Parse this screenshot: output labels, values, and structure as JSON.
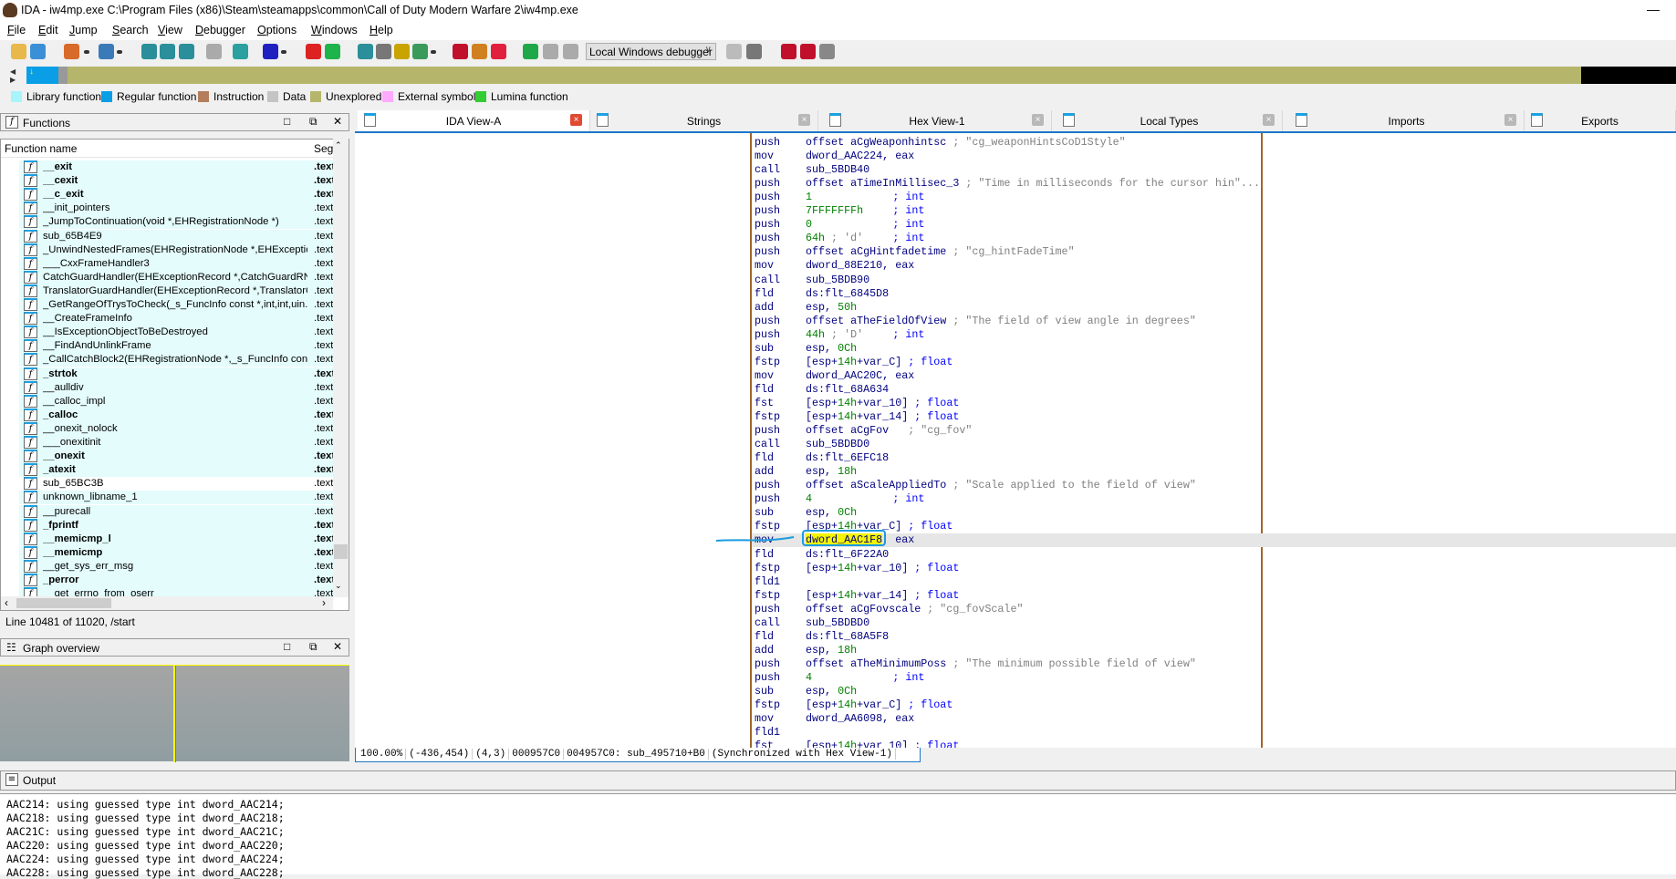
{
  "window": {
    "title": "IDA - iw4mp.exe C:\\Program Files (x86)\\Steam\\steamapps\\common\\Call of Duty Modern Warfare 2\\iw4mp.exe",
    "minimize": "—"
  },
  "menu": [
    "File",
    "Edit",
    "Jump",
    "Search",
    "View",
    "Debugger",
    "Options",
    "Windows",
    "Help"
  ],
  "toolbar": {
    "icons": [
      "open-icon",
      "save-icon",
      "back-icon",
      "dropdown-icon",
      "forward-icon",
      "dropdown-icon",
      "hex-icon",
      "text-icon",
      "binary-icon",
      "convert-icon",
      "jump-icon",
      "ascii-icon",
      "dropdown-icon",
      "segment-icon",
      "green-circle-icon",
      "code-icon",
      "data-icon",
      "unknown-icon",
      "struct-icon",
      "dropdown-icon",
      "breakpoint-icon",
      "patch-icon",
      "stop-sign-icon",
      "run-icon",
      "pause-icon",
      "stop-icon",
      "trace-icon",
      "call-trace-icon",
      "list-icon",
      "list-add-icon",
      "list-remove-icon"
    ],
    "debugger_select": "Local Windows debugger"
  },
  "legend": [
    {
      "label": "Library function",
      "color": "#a8f4fb"
    },
    {
      "label": "Regular function",
      "color": "#0a9ee6"
    },
    {
      "label": "Instruction",
      "color": "#b47e5c"
    },
    {
      "label": "Data",
      "color": "#c4c4c4"
    },
    {
      "label": "Unexplored",
      "color": "#b5b66b"
    },
    {
      "label": "External symbol",
      "color": "#ffaaff"
    },
    {
      "label": "Lumina function",
      "color": "#33cc33"
    }
  ],
  "functions_panel": {
    "title": "Functions",
    "col_name": "Function name",
    "col_seg": "Seg",
    "status": "Line 10481 of 11020, /start",
    "rows": [
      {
        "name": "__exit",
        "seg": ".text",
        "bold": true
      },
      {
        "name": "__cexit",
        "seg": ".text",
        "bold": true
      },
      {
        "name": "__c_exit",
        "seg": ".text",
        "bold": true
      },
      {
        "name": "__init_pointers",
        "seg": ".text"
      },
      {
        "name": "_JumpToContinuation(void *,EHRegistrationNode *)",
        "seg": ".text"
      },
      {
        "name": "sub_65B4E9",
        "seg": ".text"
      },
      {
        "name": "_UnwindNestedFrames(EHRegistrationNode *,EHExceptio...",
        "seg": ".text"
      },
      {
        "name": "___CxxFrameHandler3",
        "seg": ".text"
      },
      {
        "name": "CatchGuardHandler(EHExceptionRecord *,CatchGuardRN ...",
        "seg": ".text"
      },
      {
        "name": "TranslatorGuardHandler(EHExceptionRecord *,TranslatorG...",
        "seg": ".text"
      },
      {
        "name": "_GetRangeOfTrysToCheck(_s_FuncInfo const *,int,int,uin...",
        "seg": ".text"
      },
      {
        "name": "__CreateFrameInfo",
        "seg": ".text"
      },
      {
        "name": "__IsExceptionObjectToBeDestroyed",
        "seg": ".text"
      },
      {
        "name": "__FindAndUnlinkFrame",
        "seg": ".text"
      },
      {
        "name": "_CallCatchBlock2(EHRegistrationNode *,_s_FuncInfo cons...",
        "seg": ".text"
      },
      {
        "name": "_strtok",
        "seg": ".text",
        "bold": true
      },
      {
        "name": "__aulldiv",
        "seg": ".text"
      },
      {
        "name": "__calloc_impl",
        "seg": ".text"
      },
      {
        "name": "_calloc",
        "seg": ".text",
        "bold": true
      },
      {
        "name": "__onexit_nolock",
        "seg": ".text"
      },
      {
        "name": "___onexitinit",
        "seg": ".text"
      },
      {
        "name": "__onexit",
        "seg": ".text",
        "bold": true
      },
      {
        "name": "_atexit",
        "seg": ".text",
        "bold": true
      },
      {
        "name": "sub_65BC3B",
        "seg": ".text",
        "regular": true
      },
      {
        "name": "unknown_libname_1",
        "seg": ".text"
      },
      {
        "name": "__purecall",
        "seg": ".text"
      },
      {
        "name": "_fprintf",
        "seg": ".text",
        "bold": true
      },
      {
        "name": "__memicmp_l",
        "seg": ".text",
        "bold": true
      },
      {
        "name": "__memicmp",
        "seg": ".text",
        "bold": true
      },
      {
        "name": "__get_sys_err_msg",
        "seg": ".text"
      },
      {
        "name": "_perror",
        "seg": ".text",
        "bold": true
      },
      {
        "name": "__get_errno_from_oserr",
        "seg": ".text"
      }
    ]
  },
  "graph_panel": {
    "title": "Graph overview"
  },
  "tabs": [
    {
      "label": "IDA View-A",
      "active": true
    },
    {
      "label": "Strings"
    },
    {
      "label": "Hex View-1"
    },
    {
      "label": "Local Types"
    },
    {
      "label": "Imports"
    },
    {
      "label": "Exports"
    }
  ],
  "disasm": {
    "rows": [
      {
        "m": "push",
        "o": [
          [
            "o",
            "offset aCgWeaponhintsc "
          ],
          [
            "c",
            "; \"cg_weaponHintsCoD1Style\""
          ]
        ]
      },
      {
        "m": "mov",
        "o": [
          [
            "o",
            "dword_AAC224, eax"
          ]
        ]
      },
      {
        "m": "call",
        "o": [
          [
            "o",
            "sub_5BDB40"
          ]
        ]
      },
      {
        "m": "push",
        "o": [
          [
            "o",
            "offset aTimeInMillisec_3 "
          ],
          [
            "c",
            "; \"Time in milliseconds for the cursor hin\"..."
          ]
        ]
      },
      {
        "m": "push",
        "o": [
          [
            "n",
            "1"
          ]
        ],
        "t": "; int"
      },
      {
        "m": "push",
        "o": [
          [
            "n",
            "7FFFFFFFh"
          ]
        ],
        "t": "; int"
      },
      {
        "m": "push",
        "o": [
          [
            "n",
            "0"
          ]
        ],
        "t": "; int"
      },
      {
        "m": "push",
        "o": [
          [
            "n",
            "64h"
          ],
          [
            "c",
            " ; 'd'"
          ]
        ],
        "t": "; int"
      },
      {
        "m": "push",
        "o": [
          [
            "o",
            "offset aCgHintfadetime "
          ],
          [
            "c",
            "; \"cg_hintFadeTime\""
          ]
        ]
      },
      {
        "m": "mov",
        "o": [
          [
            "o",
            "dword_88E210, eax"
          ]
        ]
      },
      {
        "m": "call",
        "o": [
          [
            "o",
            "sub_5BDB90"
          ]
        ]
      },
      {
        "m": "fld",
        "o": [
          [
            "o",
            "ds:flt_6845D8"
          ]
        ]
      },
      {
        "m": "add",
        "o": [
          [
            "o",
            "esp, "
          ],
          [
            "n",
            "50h"
          ]
        ]
      },
      {
        "m": "push",
        "o": [
          [
            "o",
            "offset aTheFieldOfView "
          ],
          [
            "c",
            "; \"The field of view angle in degrees\""
          ]
        ]
      },
      {
        "m": "push",
        "o": [
          [
            "n",
            "44h"
          ],
          [
            "c",
            " ; 'D'"
          ]
        ],
        "t": "; int"
      },
      {
        "m": "sub",
        "o": [
          [
            "o",
            "esp, "
          ],
          [
            "n",
            "0Ch"
          ]
        ]
      },
      {
        "m": "fstp",
        "o": [
          [
            "o",
            "[esp+"
          ],
          [
            "n",
            "14h"
          ],
          [
            "o",
            "+var_C] "
          ],
          [
            "t",
            "; float"
          ]
        ]
      },
      {
        "m": "mov",
        "o": [
          [
            "o",
            "dword_AAC20C, eax"
          ]
        ]
      },
      {
        "m": "fld",
        "o": [
          [
            "o",
            "ds:flt_68A634"
          ]
        ]
      },
      {
        "m": "fst",
        "o": [
          [
            "o",
            "[esp+"
          ],
          [
            "n",
            "14h"
          ],
          [
            "o",
            "+var_10] "
          ],
          [
            "t",
            "; float"
          ]
        ]
      },
      {
        "m": "fstp",
        "o": [
          [
            "o",
            "[esp+"
          ],
          [
            "n",
            "14h"
          ],
          [
            "o",
            "+var_14] "
          ],
          [
            "t",
            "; float"
          ]
        ]
      },
      {
        "m": "push",
        "o": [
          [
            "o",
            "offset aCgFov   "
          ],
          [
            "c",
            "; \"cg_fov\""
          ]
        ]
      },
      {
        "m": "call",
        "o": [
          [
            "o",
            "sub_5BDBD0"
          ]
        ]
      },
      {
        "m": "fld",
        "o": [
          [
            "o",
            "ds:flt_6EFC18"
          ]
        ]
      },
      {
        "m": "add",
        "o": [
          [
            "o",
            "esp, "
          ],
          [
            "n",
            "18h"
          ]
        ]
      },
      {
        "m": "push",
        "o": [
          [
            "o",
            "offset aScaleAppliedTo "
          ],
          [
            "c",
            "; \"Scale applied to the field of view\""
          ]
        ]
      },
      {
        "m": "push",
        "o": [
          [
            "n",
            "4"
          ]
        ],
        "t": "; int"
      },
      {
        "m": "sub",
        "o": [
          [
            "o",
            "esp, "
          ],
          [
            "n",
            "0Ch"
          ]
        ]
      },
      {
        "m": "fstp",
        "o": [
          [
            "o",
            "[esp+"
          ],
          [
            "n",
            "14h"
          ],
          [
            "o",
            "+var_C] "
          ],
          [
            "t",
            "; float"
          ]
        ]
      },
      {
        "m": "mov",
        "o": [
          [
            "y",
            "dword_AAC1F8"
          ],
          [
            "o",
            ", eax"
          ]
        ],
        "highlighted": true
      },
      {
        "m": "fld",
        "o": [
          [
            "o",
            "ds:flt_6F22A0"
          ]
        ]
      },
      {
        "m": "fstp",
        "o": [
          [
            "o",
            "[esp+"
          ],
          [
            "n",
            "14h"
          ],
          [
            "o",
            "+var_10] "
          ],
          [
            "t",
            "; float"
          ]
        ]
      },
      {
        "m": "fld1",
        "o": []
      },
      {
        "m": "fstp",
        "o": [
          [
            "o",
            "[esp+"
          ],
          [
            "n",
            "14h"
          ],
          [
            "o",
            "+var_14] "
          ],
          [
            "t",
            "; float"
          ]
        ]
      },
      {
        "m": "push",
        "o": [
          [
            "o",
            "offset aCgFovscale "
          ],
          [
            "c",
            "; \"cg_fovScale\""
          ]
        ]
      },
      {
        "m": "call",
        "o": [
          [
            "o",
            "sub_5BDBD0"
          ]
        ]
      },
      {
        "m": "fld",
        "o": [
          [
            "o",
            "ds:flt_68A5F8"
          ]
        ]
      },
      {
        "m": "add",
        "o": [
          [
            "o",
            "esp, "
          ],
          [
            "n",
            "18h"
          ]
        ]
      },
      {
        "m": "push",
        "o": [
          [
            "o",
            "offset aTheMinimumPoss "
          ],
          [
            "c",
            "; \"The minimum possible field of view\""
          ]
        ]
      },
      {
        "m": "push",
        "o": [
          [
            "n",
            "4"
          ]
        ],
        "t": "; int"
      },
      {
        "m": "sub",
        "o": [
          [
            "o",
            "esp, "
          ],
          [
            "n",
            "0Ch"
          ]
        ]
      },
      {
        "m": "fstp",
        "o": [
          [
            "o",
            "[esp+"
          ],
          [
            "n",
            "14h"
          ],
          [
            "o",
            "+var_C] "
          ],
          [
            "t",
            "; float"
          ]
        ]
      },
      {
        "m": "mov",
        "o": [
          [
            "o",
            "dword_AA6098, eax"
          ]
        ]
      },
      {
        "m": "fld1",
        "o": []
      },
      {
        "m": "fst",
        "o": [
          [
            "o",
            "[esp+"
          ],
          [
            "n",
            "14h"
          ],
          [
            "o",
            "+var_10] "
          ],
          [
            "t",
            "; float"
          ]
        ]
      }
    ]
  },
  "statusbar": [
    "100.00%",
    "(-436,454)",
    "(4,3)",
    "000957C0",
    "004957C0: sub_495710+B0",
    "(Synchronized with Hex View-1)"
  ],
  "output_panel": {
    "title": "Output",
    "lines": [
      "AAC214: using guessed type int dword_AAC214;",
      "AAC218: using guessed type int dword_AAC218;",
      "AAC21C: using guessed type int dword_AAC21C;",
      "AAC220: using guessed type int dword_AAC220;",
      "AAC224: using guessed type int dword_AAC224;",
      "AAC228: using guessed type int dword_AAC228;"
    ]
  }
}
